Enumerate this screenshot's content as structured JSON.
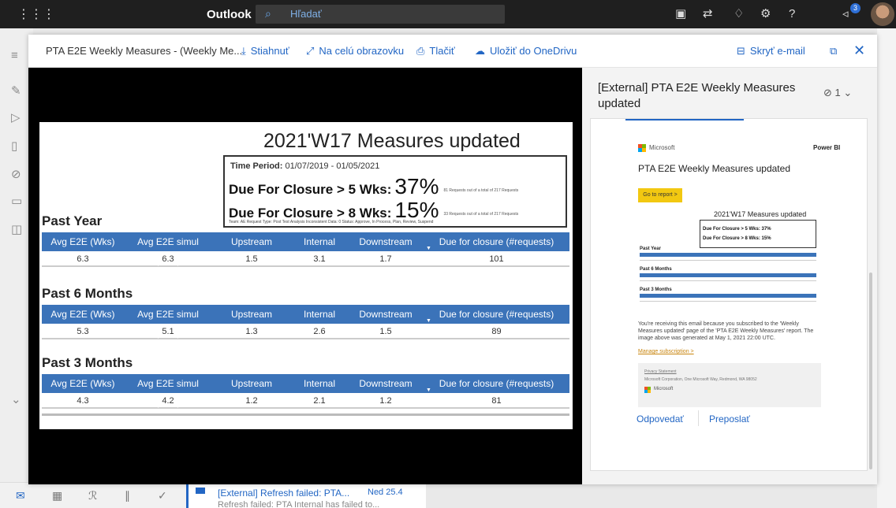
{
  "topbar": {
    "app_name": "Outlook",
    "search_placeholder": "Hľadať",
    "notification_count": "3"
  },
  "background": {
    "message_subject": "[External] Refresh failed: PTA...",
    "message_date": "Ned 25.4",
    "message_preview": "Refresh failed: PTA Internal has failed to..."
  },
  "modal": {
    "file_title": "PTA E2E Weekly Measures - (Weekly Me...",
    "download": "Stiahnuť",
    "fullscreen": "Na celú obrazovku",
    "print": "Tlačiť",
    "save_onedrive": "Uložiť do OneDrivu",
    "hide_email": "Skryť e-mail"
  },
  "report": {
    "title": "2021'W17 Measures updated",
    "period_label": "Time Period:",
    "period_value": "01/07/2019 - 01/05/2021",
    "due5_label": "Due For Closure > 5 Wks:",
    "due5_pct": "37%",
    "due5_note": "81 Requests out of a total of 217 Requests",
    "due8_label": "Due For Closure > 8 Wks:",
    "due8_pct": "15%",
    "due8_note": "33 Requests out of a total of 217 Requests",
    "meta": "Team: AE Request Type: Post Test Analysis Inconsistent Data: 0 Status: Approve, In Process, Plan, Review, Suspend",
    "headers": [
      "Avg E2E (Wks)",
      "Avg E2E simul (Wks)",
      "Upstream",
      "Internal",
      "Downstream",
      "Due for closure (#requests)"
    ],
    "sections": [
      {
        "title": "Past Year",
        "values": [
          "6.3",
          "6.3",
          "1.5",
          "3.1",
          "1.7",
          "101"
        ]
      },
      {
        "title": "Past 6 Months",
        "values": [
          "5.3",
          "5.1",
          "1.3",
          "2.6",
          "1.5",
          "89"
        ]
      },
      {
        "title": "Past 3 Months",
        "values": [
          "4.3",
          "4.2",
          "1.2",
          "2.1",
          "1.2",
          "81"
        ]
      }
    ]
  },
  "email": {
    "subject": "[External] PTA E2E Weekly Measures updated",
    "attachments": "1",
    "brand": "Microsoft",
    "product": "Power BI",
    "card_title": "PTA E2E Weekly Measures updated",
    "go_to_report": "Go to report >",
    "thumb_title": "2021'W17 Measures updated",
    "thumb_due5": "Due For Closure > 5 Wks: 37%",
    "thumb_due8": "Due For Closure > 8 Wks: 15%",
    "thumb_sections": [
      "Past Year",
      "Past 6 Months",
      "Past 3 Months"
    ],
    "body_text": "You're receiving this email because you subscribed to the 'Weekly Measures updated' page of the 'PTA E2E Weekly Measures' report. The image above was generated at May 1, 2021 22:00 UTC.",
    "manage": "Manage subscription >",
    "privacy": "Privacy Statement",
    "address": "Microsoft Corporation, One Microsoft Way, Redmond, WA 98052",
    "footer_brand": "Microsoft",
    "reply": "Odpovedať",
    "forward": "Preposlať"
  }
}
